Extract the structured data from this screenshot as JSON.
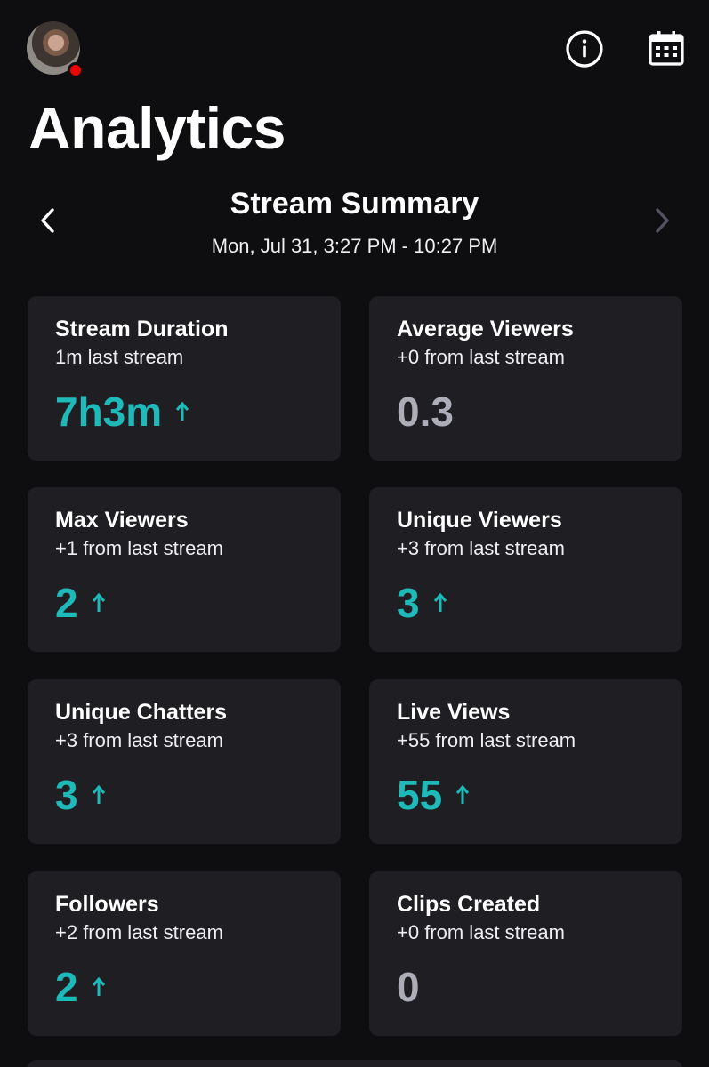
{
  "header": {
    "title": "Analytics"
  },
  "icons": {
    "info": "info-circle-icon",
    "calendar": "calendar-icon",
    "prev": "chevron-left-icon",
    "next": "chevron-right-icon",
    "trend_up": "arrow-up-icon"
  },
  "summary": {
    "title": "Stream Summary",
    "range": "Mon, Jul 31, 3:27 PM - 10:27 PM"
  },
  "colors": {
    "background": "#0e0e10",
    "card": "#1f1f23",
    "accent_up": "#1eb9b9",
    "neutral_value": "#adadb8",
    "live_dot": "#eb0400"
  },
  "cards": [
    {
      "title": "Stream Duration",
      "subtitle": "1m last stream",
      "value": "7h3m",
      "trend": "up"
    },
    {
      "title": "Average Viewers",
      "subtitle": "+0 from last stream",
      "value": "0.3",
      "trend": "flat"
    },
    {
      "title": "Max Viewers",
      "subtitle": "+1 from last stream",
      "value": "2",
      "trend": "up"
    },
    {
      "title": "Unique Viewers",
      "subtitle": "+3 from last stream",
      "value": "3",
      "trend": "up"
    },
    {
      "title": "Unique Chatters",
      "subtitle": "+3 from last stream",
      "value": "3",
      "trend": "up"
    },
    {
      "title": "Live Views",
      "subtitle": "+55 from last stream",
      "value": "55",
      "trend": "up"
    },
    {
      "title": "Followers",
      "subtitle": "+2 from last stream",
      "value": "2",
      "trend": "up"
    },
    {
      "title": "Clips Created",
      "subtitle": "+0 from last stream",
      "value": "0",
      "trend": "flat"
    }
  ]
}
